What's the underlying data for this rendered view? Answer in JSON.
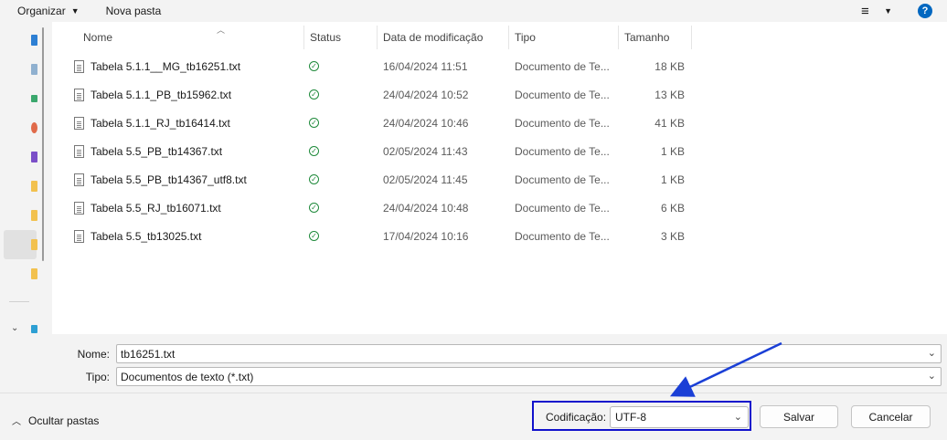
{
  "toolbar": {
    "organize_label": "Organizar",
    "new_folder_label": "Nova pasta",
    "help_label": "?"
  },
  "columns": {
    "name": "Nome",
    "status": "Status",
    "modified": "Data de modificação",
    "type": "Tipo",
    "size": "Tamanho"
  },
  "files": [
    {
      "name": "Tabela 5.1.1__MG_tb16251.txt",
      "modified": "16/04/2024 11:51",
      "type": "Documento de Te...",
      "size": "18 KB"
    },
    {
      "name": "Tabela 5.1.1_PB_tb15962.txt",
      "modified": "24/04/2024 10:52",
      "type": "Documento de Te...",
      "size": "13 KB"
    },
    {
      "name": "Tabela 5.1.1_RJ_tb16414.txt",
      "modified": "24/04/2024 10:46",
      "type": "Documento de Te...",
      "size": "41 KB"
    },
    {
      "name": "Tabela 5.5_PB_tb14367.txt",
      "modified": "02/05/2024 11:43",
      "type": "Documento de Te...",
      "size": "1 KB"
    },
    {
      "name": "Tabela 5.5_PB_tb14367_utf8.txt",
      "modified": "02/05/2024 11:45",
      "type": "Documento de Te...",
      "size": "1 KB"
    },
    {
      "name": "Tabela 5.5_RJ_tb16071.txt",
      "modified": "24/04/2024 10:48",
      "type": "Documento de Te...",
      "size": "6 KB"
    },
    {
      "name": "Tabela 5.5_tb13025.txt",
      "modified": "17/04/2024 10:16",
      "type": "Documento de Te...",
      "size": "3 KB"
    }
  ],
  "form": {
    "name_label": "Nome:",
    "name_value": "tb16251.txt",
    "type_label": "Tipo:",
    "type_value": "Documentos de texto (*.txt)",
    "encoding_label": "Codificação:",
    "encoding_value": "UTF-8"
  },
  "footer": {
    "hide_folders_label": "Ocultar pastas",
    "save_label": "Salvar",
    "cancel_label": "Cancelar"
  },
  "icons": {
    "status": "sync-check-icon",
    "file": "text-file-icon"
  },
  "colors": {
    "accent": "#0067c0",
    "status_ok": "#1f8a3b",
    "highlight_box": "#1111cc",
    "arrow": "#1a3fd6"
  }
}
